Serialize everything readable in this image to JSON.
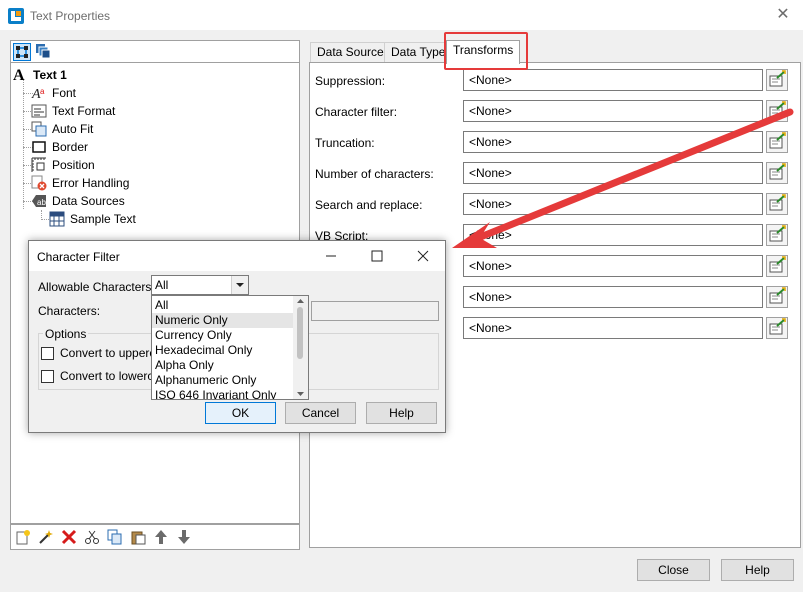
{
  "window": {
    "title": "Text Properties"
  },
  "tree": {
    "root": "Text 1",
    "items": [
      {
        "label": "Font",
        "icon": "font-icon"
      },
      {
        "label": "Text Format",
        "icon": "text-format-icon"
      },
      {
        "label": "Auto Fit",
        "icon": "auto-fit-icon"
      },
      {
        "label": "Border",
        "icon": "border-icon"
      },
      {
        "label": "Position",
        "icon": "position-icon"
      },
      {
        "label": "Error Handling",
        "icon": "error-handling-icon"
      },
      {
        "label": "Data Sources",
        "icon": "data-sources-icon"
      },
      {
        "label": "Sample Text",
        "icon": "sample-text-icon"
      }
    ]
  },
  "tabs": [
    "Data Source",
    "Data Type",
    "Transforms"
  ],
  "transforms": {
    "rows": [
      {
        "label": "Suppression:",
        "value": "<None>"
      },
      {
        "label": "Character filter:",
        "value": "<None>"
      },
      {
        "label": "Truncation:",
        "value": "<None>"
      },
      {
        "label": "Number of characters:",
        "value": "<None>"
      },
      {
        "label": "Search and replace:",
        "value": "<None>"
      },
      {
        "label": "VB Script:",
        "value": "<None>"
      },
      {
        "label": "",
        "value": "<None>"
      },
      {
        "label": "",
        "value": "<None>"
      },
      {
        "label": "",
        "value": "<None>"
      }
    ]
  },
  "buttons": {
    "close": "Close",
    "help": "Help"
  },
  "dialog": {
    "title": "Character Filter",
    "allowable_label": "Allowable Characters:",
    "selected": "All",
    "characters_label": "Characters:",
    "options_label": "Options",
    "uppercase_label": "Convert to upperca",
    "lowercase_label": "Convert to lowercas",
    "options": [
      "All",
      "Numeric Only",
      "Currency Only",
      "Hexadecimal Only",
      "Alpha Only",
      "Alphanumeric Only",
      "ISO 646 Invariant Only"
    ],
    "ok": "OK",
    "cancel": "Cancel",
    "help": "Help"
  },
  "colors": {
    "highlight": "#e53a3a",
    "accent": "#0078d7"
  }
}
